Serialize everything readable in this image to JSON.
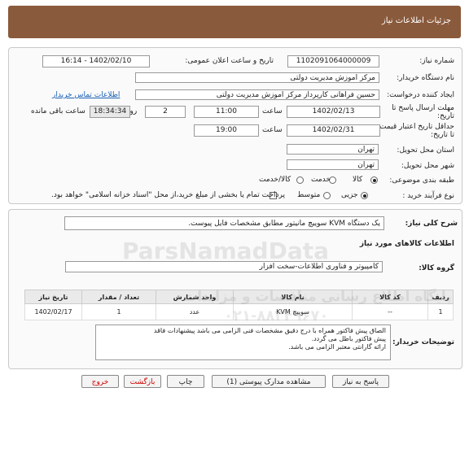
{
  "header": {
    "title": "جزئیات اطلاعات نیاز"
  },
  "need_number": {
    "label": "شماره نیاز:",
    "value": "1102091064000009"
  },
  "announce_date": {
    "label": "تاریخ و ساعت اعلان عمومی:",
    "value": "1402/02/10 - 16:14"
  },
  "buyer_org": {
    "label": "نام دستگاه خریدار:",
    "value": "مرکز اموزش مدیریت دولتی"
  },
  "requester": {
    "label": "ایجاد کننده درخواست:",
    "value": "حسین  فراهانی کارپرداز مرکز اموزش مدیریت دولتی",
    "contact_link": "اطلاعات تماس خریدار"
  },
  "deadline": {
    "label": "مهلت ارسال پاسخ تا تاریخ:",
    "date": "1402/02/13",
    "time_label": "ساعت",
    "time": "11:00",
    "days": "2",
    "days_label": "روز و",
    "remaining": "18:34:34",
    "remaining_label": "ساعت باقی مانده"
  },
  "validity": {
    "label": "حداقل تاریخ اعتبار قیمت تا تاریخ:",
    "date": "1402/02/31",
    "time_label": "ساعت",
    "time": "19:00"
  },
  "province": {
    "label": "استان محل تحویل:",
    "value": "تهران"
  },
  "city": {
    "label": "شهر محل تحویل:",
    "value": "تهران"
  },
  "category": {
    "label": "طبقه بندی موضوعی:",
    "options": [
      "کالا",
      "خدمت",
      "کالا/خدمت"
    ],
    "selected": "کالا"
  },
  "process": {
    "label": "نوع فرآیند خرید :",
    "options": [
      "جزیی",
      "متوسط"
    ],
    "selected": "جزیی",
    "payment_note": "پرداخت تمام یا بخشی از مبلغ خرید،از محل \"اسناد خزانه اسلامی\" خواهد بود."
  },
  "summary": {
    "label": "شرح کلی نیاز:",
    "value": "یک دستگاه KVM سوییچ مانیتور مطابق مشخصات فایل پیوست."
  },
  "goods_info_title": "اطلاعات کالاهای مورد نیاز",
  "goods_group": {
    "label": "گروه کالا:",
    "value": "کامپیوتر و فناوری اطلاعات-سخت افزار"
  },
  "table": {
    "headers": [
      "ردیف",
      "کد کالا",
      "نام کالا",
      "واحد شمارش",
      "تعداد / مقدار",
      "تاریخ نیاز"
    ],
    "rows": [
      [
        "1",
        "--",
        "سوییچ KVM",
        "عدد",
        "1",
        "1402/02/17"
      ]
    ]
  },
  "buyer_notes": {
    "label": "توضیحات خریدار:",
    "lines": [
      "الصاق پیش فاکتور همراه با درج دقیق مشخصات فنی الزامی می باشد پیشنهادات فاقد",
      "پیش فاکتور باطل می گردد.",
      "ارائه گارانتی معتبر الزامی می باشد."
    ]
  },
  "buttons": {
    "reply": "پاسخ به نیاز",
    "docs": "مشاهده مدارک پیوستی (1)",
    "print": "چاپ",
    "back": "بازگشت",
    "exit": "خروج"
  },
  "watermark": {
    "brand": "ParsNamadData",
    "fa1": "پایگاه اطلاع رسانی مناقصات و مزایدات",
    "phone": "۰۲۱-۸۸۳۴۹۶۷۰"
  }
}
